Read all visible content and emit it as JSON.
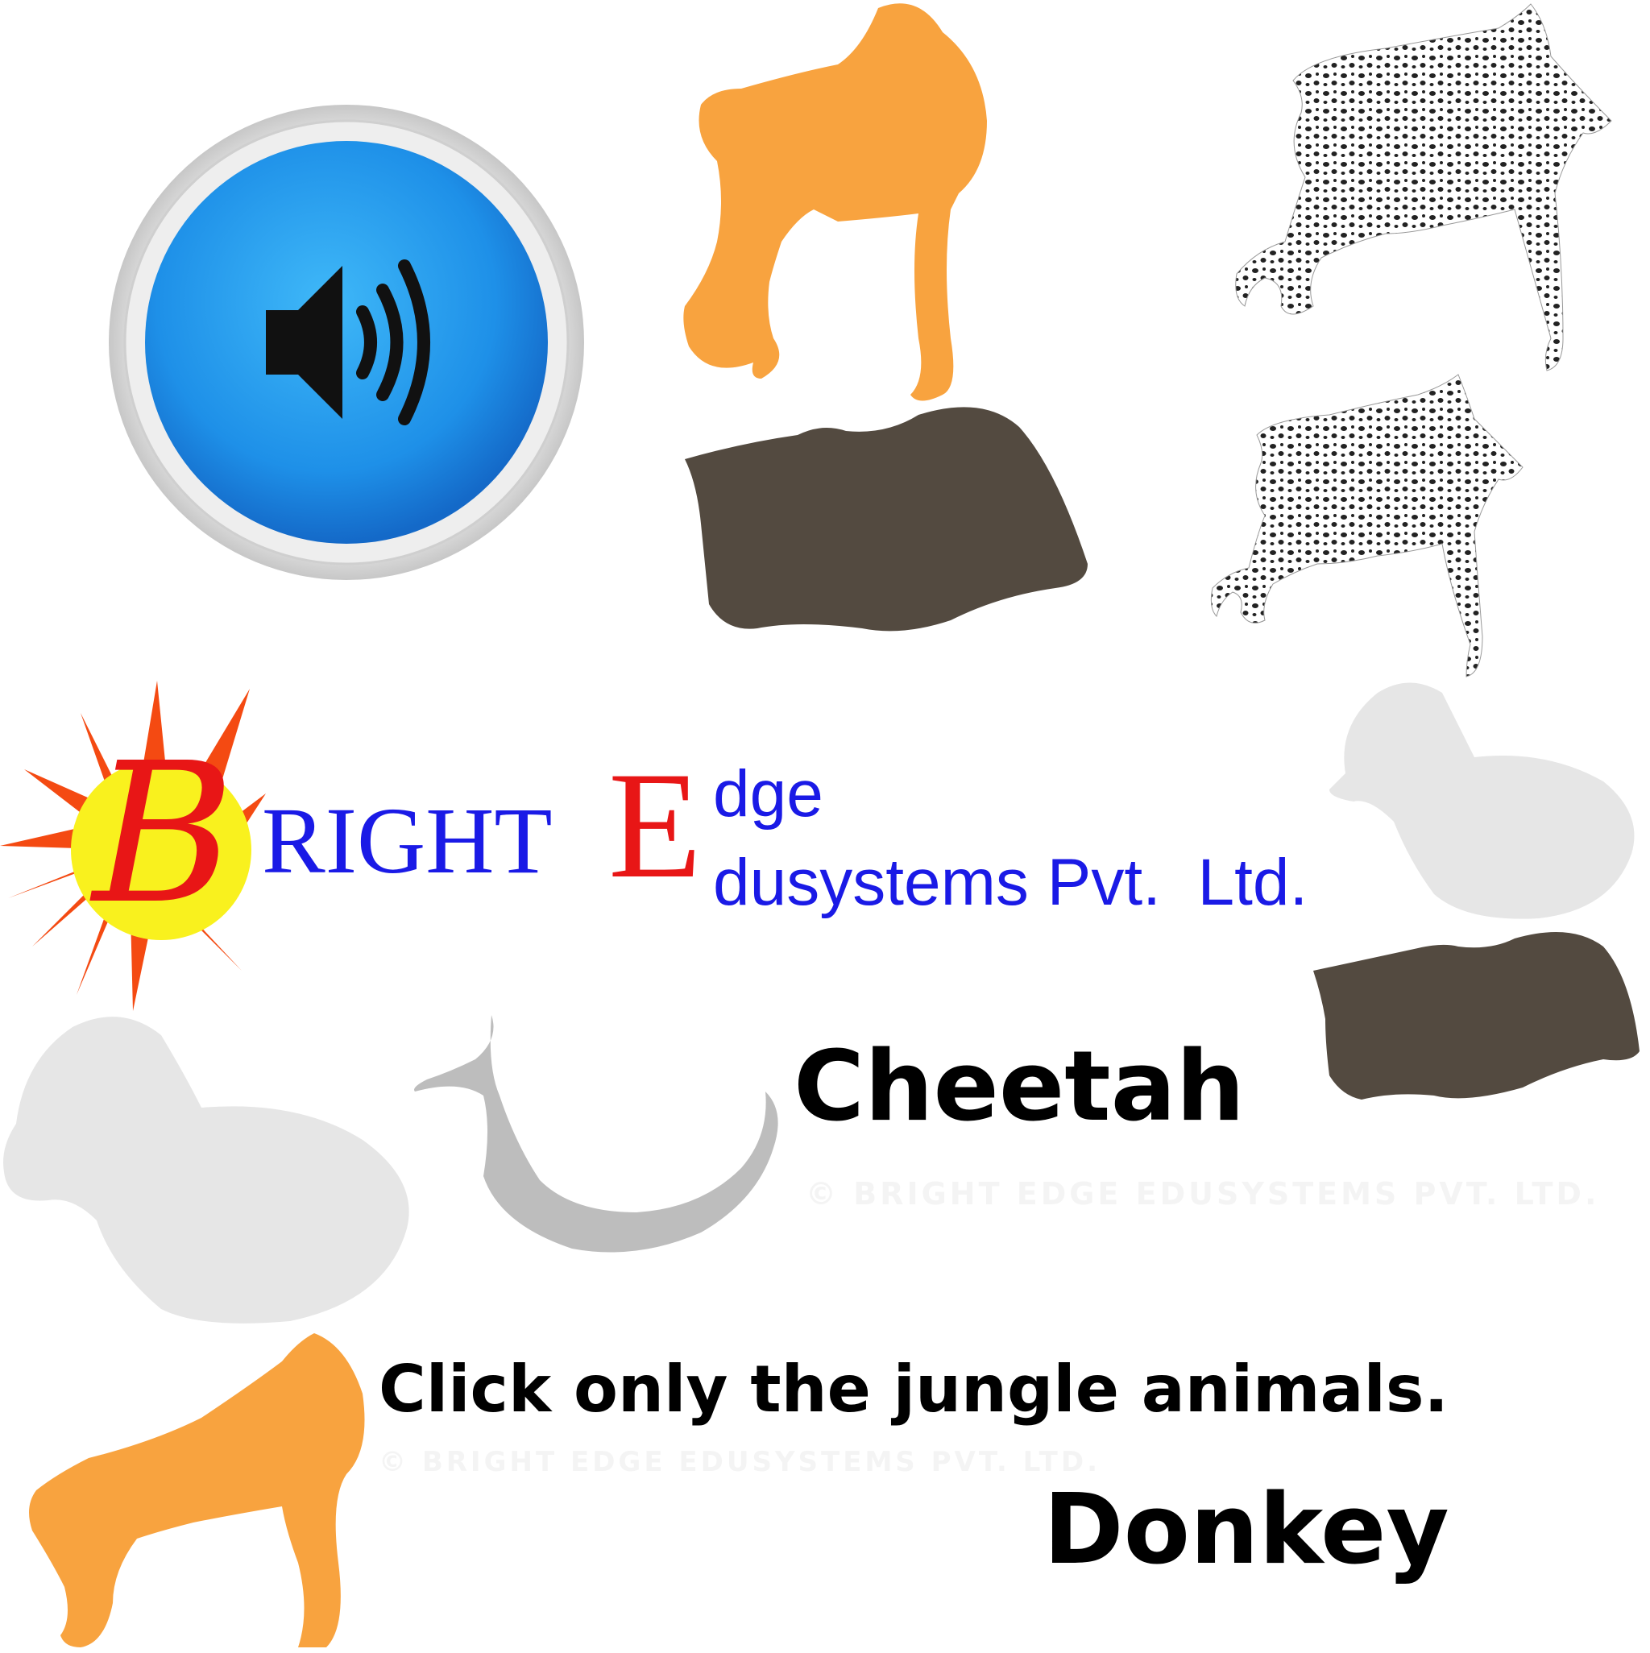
{
  "logo": {
    "letter_b": "B",
    "word_right": "RIGHT",
    "letter_e": "E",
    "word_dge": "dge",
    "word_edu": "dusystems Pvt.  Ltd."
  },
  "words": {
    "cheetah": "Cheetah",
    "donkey": "Donkey"
  },
  "instruction": "Click only the jungle animals.",
  "watermark": "© BRIGHT EDGE EDUSYSTEMS PVT. LTD.",
  "audio_button": {
    "icon": "speaker-icon"
  },
  "colors": {
    "orange": "#F8A33F",
    "brown": "#534A40",
    "light_gray": "#E6E6E6",
    "mid_gray": "#BDBDBD",
    "blue": "#1E90E8",
    "logo_blue": "#1A1AE6",
    "logo_red": "#E81616"
  }
}
